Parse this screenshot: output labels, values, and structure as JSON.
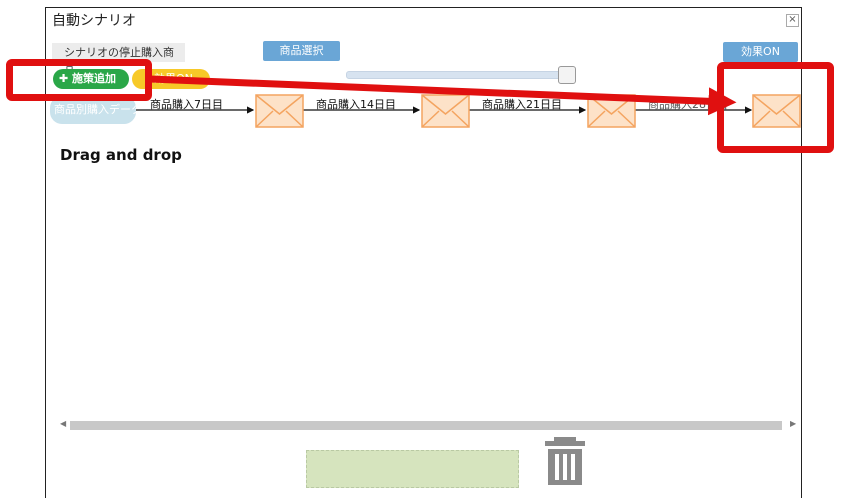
{
  "dialog": {
    "title": "自動シナリオ",
    "close_icon": "close-icon"
  },
  "toolbar": {
    "stop_label": "シナリオの停止購入商品:",
    "select_button": "商品選択",
    "effect_button": "効果ON",
    "add_button": "✚ 施策追加",
    "yellow_button": "効果ON"
  },
  "scenario": {
    "start_node": "商品別購入データ",
    "steps": [
      {
        "label": "商品購入7日目",
        "icon": "envelope-icon"
      },
      {
        "label": "商品購入14日目",
        "icon": "envelope-icon"
      },
      {
        "label": "商品購入21日目",
        "icon": "envelope-icon"
      },
      {
        "label": "商品購入28日目",
        "icon": "envelope-icon"
      }
    ]
  },
  "annotation": {
    "text": "Drag and drop",
    "color": "#e01010"
  },
  "colors": {
    "envelope_fill": "#fde2c8",
    "envelope_stroke": "#f4a460",
    "green": "#2aa748",
    "blue_button": "#6aa6d6",
    "drop_zone": "#d6e4be"
  }
}
